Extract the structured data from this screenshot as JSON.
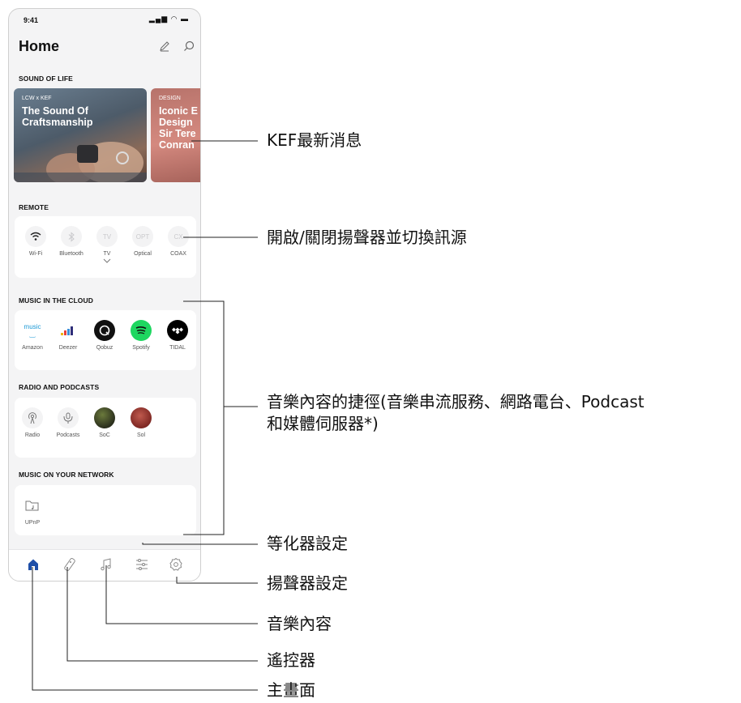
{
  "status": {
    "time": "9:41"
  },
  "header": {
    "title": "Home"
  },
  "sections": {
    "sound_of_life": "SOUND OF LIFE",
    "remote": "REMOTE",
    "cloud": "MUSIC IN THE CLOUD",
    "radio": "RADIO AND PODCASTS",
    "network": "MUSIC ON YOUR NETWORK"
  },
  "news": [
    {
      "tag": "LCW x KEF",
      "headline": "The Sound Of\nCraftsmanship"
    },
    {
      "tag": "DESIGN",
      "headline": "Iconic E\nDesign\nSir Tere\nConran"
    }
  ],
  "remote": [
    {
      "label": "Wi-Fi",
      "glyph": "wifi-icon"
    },
    {
      "label": "Bluetooth",
      "glyph": "bluetooth-icon"
    },
    {
      "label": "TV",
      "glyph": "TV"
    },
    {
      "label": "Optical",
      "glyph": "OPT"
    },
    {
      "label": "COAX",
      "glyph": "CX"
    }
  ],
  "cloud": [
    {
      "label": "Amazon",
      "glyph": "music"
    },
    {
      "label": "Deezer"
    },
    {
      "label": "Qobuz"
    },
    {
      "label": "Spotify"
    },
    {
      "label": "TIDAL"
    }
  ],
  "radio": [
    {
      "label": "Radio"
    },
    {
      "label": "Podcasts"
    },
    {
      "label": "SoC"
    },
    {
      "label": "Sol"
    }
  ],
  "network": [
    {
      "label": "UPnP"
    }
  ],
  "annotations": {
    "news": "KEF最新消息",
    "source": "開啟/關閉揚聲器並切換訊源",
    "shortcuts_1": "音樂內容的捷徑(音樂串流服務、網路電台、Podcast",
    "shortcuts_2": "和媒體伺服器*)",
    "eq": "等化器設定",
    "speaker": "揚聲器設定",
    "music": "音樂內容",
    "remote": "遙控器",
    "home": "主畫面"
  },
  "colors": {
    "tab_active": "#1f4fa8",
    "spotify": "#1ed760",
    "line": "#222222"
  }
}
